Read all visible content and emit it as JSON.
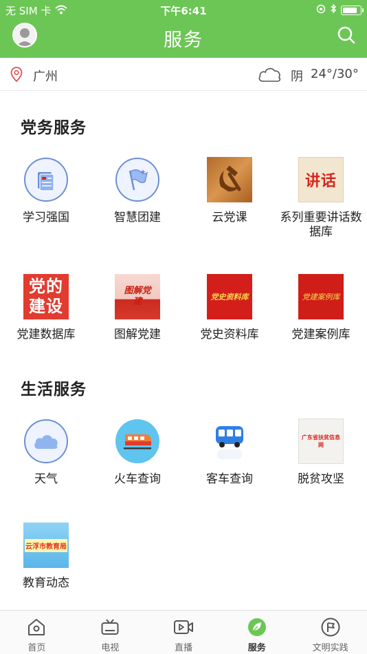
{
  "status_bar": {
    "carrier": "无 SIM 卡",
    "time": "下午6:41",
    "battery_level": 0.85
  },
  "header": {
    "title": "服务",
    "avatar_icon": "user-avatar-icon",
    "search_icon": "search-icon"
  },
  "weather": {
    "city": "广州",
    "condition": "阴",
    "temperature": "24°/30°"
  },
  "sections": [
    {
      "title": "党务服务",
      "items": [
        {
          "label": "学习强国",
          "icon": "xuexi-qiangguo-icon"
        },
        {
          "label": "智慧团建",
          "icon": "flag-icon"
        },
        {
          "label": "云党课",
          "icon": "hammer-sickle-icon"
        },
        {
          "label": "系列重要讲话数据库",
          "icon": "speech-tile-icon",
          "tile_text": "讲话"
        },
        {
          "label": "党建数据库",
          "icon": "party-building-tile-icon",
          "tile_text": "党的建设"
        },
        {
          "label": "图解党建",
          "icon": "illustrated-party-tile-icon",
          "tile_text": "图解党建"
        },
        {
          "label": "党史资料库",
          "icon": "party-history-tile-icon",
          "tile_text": "党史资料库"
        },
        {
          "label": "党建案例库",
          "icon": "party-case-tile-icon",
          "tile_text": "党建案例库"
        }
      ]
    },
    {
      "title": "生活服务",
      "items": [
        {
          "label": "天气",
          "icon": "cloud-icon"
        },
        {
          "label": "火车查询",
          "icon": "train-icon"
        },
        {
          "label": "客车查询",
          "icon": "bus-icon"
        },
        {
          "label": "脱贫攻坚",
          "icon": "poverty-alleviation-tile-icon",
          "tile_text": "广东省扶贫信息网"
        },
        {
          "label": "教育动态",
          "icon": "education-bureau-tile-icon",
          "tile_text": "云浮市教育局"
        }
      ]
    }
  ],
  "tabbar": {
    "tabs": [
      {
        "label": "首页",
        "icon": "home-icon"
      },
      {
        "label": "电视",
        "icon": "tv-icon"
      },
      {
        "label": "直播",
        "icon": "live-video-icon"
      },
      {
        "label": "服务",
        "icon": "service-leaf-icon",
        "active": true
      },
      {
        "label": "文明实践",
        "icon": "flag-circle-icon"
      }
    ]
  },
  "colors": {
    "brand_green": "#6cc655",
    "icon_blue": "#6b8fd6",
    "party_red": "#d9261c"
  }
}
